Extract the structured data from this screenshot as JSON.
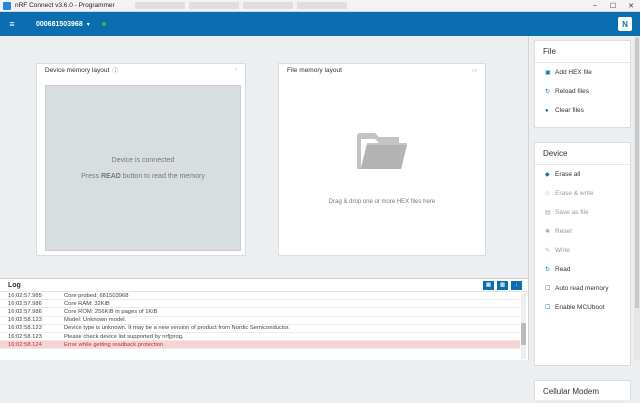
{
  "window": {
    "title": "nRF Connect v3.6.0 - Programmer"
  },
  "appbar": {
    "device_serial": "000681503968"
  },
  "device_memory": {
    "title": "Device memory layout",
    "message": "Device is connected",
    "instruction_pre": "Press ",
    "instruction_bold": "READ",
    "instruction_post": " button to read the memory"
  },
  "file_memory": {
    "title": "File memory layout",
    "drop_text": "Drag & drop one or more HEX files here"
  },
  "log": {
    "title": "Log",
    "rows": [
      {
        "time": "16:02:57.985",
        "msg": "Core probed: 681503968",
        "level": "info"
      },
      {
        "time": "16:02:57.986",
        "msg": "Core RAM: 32KiB",
        "level": "info"
      },
      {
        "time": "16:02:57.986",
        "msg": "Core ROM: 256KiB in pages of 1KiB",
        "level": "info"
      },
      {
        "time": "16:02:58.123",
        "msg": "Model: Unknown model.",
        "level": "info"
      },
      {
        "time": "16:02:58.123",
        "msg": "Device type is unknown. It may be a new version of product from Nordic Semiconductor.",
        "level": "info"
      },
      {
        "time": "16:02:58.123",
        "msg": "Please check device list supported by nrfjprog.",
        "level": "info"
      },
      {
        "time": "16:02:58.124",
        "msg": "Error while getting readback protection",
        "level": "error"
      }
    ]
  },
  "sidebar": {
    "file": {
      "title": "File",
      "items": [
        {
          "label": "Add HEX file",
          "icon": "folder-icon",
          "glyph": "▣"
        },
        {
          "label": "Reload files",
          "icon": "refresh-icon",
          "glyph": "↻"
        },
        {
          "label": "Clear files",
          "icon": "minus-circle-icon",
          "glyph": "●"
        }
      ]
    },
    "device": {
      "title": "Device",
      "items": [
        {
          "label": "Erase all",
          "icon": "eraser-icon",
          "glyph": "◆",
          "enabled": true
        },
        {
          "label": "Erase & write",
          "icon": "eraser-write-icon",
          "glyph": "◇",
          "enabled": false
        },
        {
          "label": "Save as file",
          "icon": "save-icon",
          "glyph": "▤",
          "enabled": false
        },
        {
          "label": "Reset",
          "icon": "reset-icon",
          "glyph": "✱",
          "enabled": false
        },
        {
          "label": "Write",
          "icon": "pencil-icon",
          "glyph": "✎",
          "enabled": false
        },
        {
          "label": "Read",
          "icon": "refresh-icon",
          "glyph": "↻",
          "enabled": true
        },
        {
          "label": "Auto read memory",
          "icon": "checkbox-icon",
          "glyph": "☐",
          "enabled": true
        },
        {
          "label": "Enable MCUboot",
          "icon": "checkbox-icon",
          "glyph": "☐",
          "enabled": true
        }
      ]
    },
    "modem": {
      "title": "Cellular Modem"
    }
  }
}
